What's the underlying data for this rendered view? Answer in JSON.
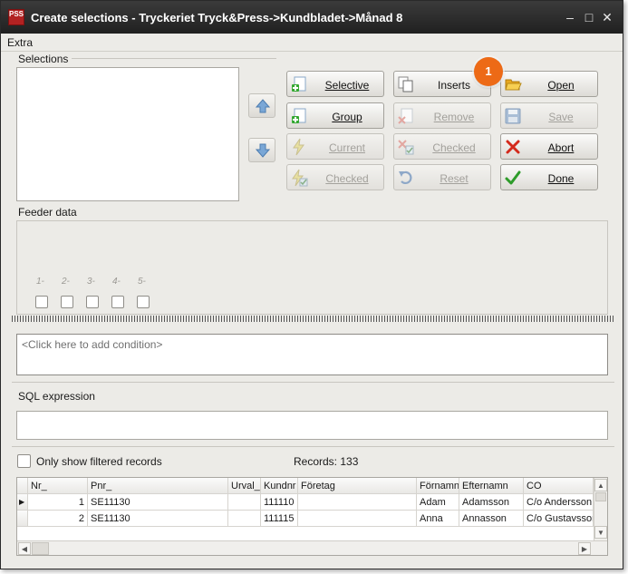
{
  "window": {
    "app_icon_text": "PSS",
    "title": "Create selections - Tryckeriet Tryck&Press->Kundbladet->Månad 8",
    "minimize": "–",
    "maximize": "□",
    "close": "✕"
  },
  "menu": {
    "extra": "Extra"
  },
  "selections": {
    "label": "Selections"
  },
  "buttons": {
    "selective": "Selective",
    "group": "Group",
    "current": "Current",
    "checked_left": "Checked",
    "inserts": "Inserts",
    "remove": "Remove",
    "checked_mid": "Checked",
    "reset": "Reset",
    "open": "Open",
    "save": "Save",
    "abort": "Abort",
    "done": "Done"
  },
  "badge": "1",
  "feeder": {
    "label": "Feeder data",
    "numbers": [
      "1-",
      "2-",
      "3-",
      "4-",
      "5-"
    ]
  },
  "condition": {
    "placeholder": "<Click here to add condition>"
  },
  "sql": {
    "label": "SQL expression",
    "value": ""
  },
  "filter": {
    "label": "Only show filtered records",
    "records": "Records: 133"
  },
  "grid": {
    "columns": [
      "Nr_",
      "Pnr_",
      "Urval_",
      "Kundnr",
      "Företag",
      "Förnamn",
      "Efternamn",
      "CO"
    ],
    "rows": [
      [
        "1",
        "SE11130",
        "",
        "111110",
        "",
        "Adam",
        "Adamsson",
        "C/o Andersson"
      ],
      [
        "2",
        "SE11130",
        "",
        "111115",
        "",
        "Anna",
        "Annasson",
        "C/o Gustavsson"
      ]
    ]
  },
  "icons": {
    "selective": "plus-page-icon",
    "group": "plus-page-icon",
    "current": "lightning-icon",
    "checked_left": "lightning-check-icon",
    "inserts": "copy-pages-icon",
    "remove": "red-x-page-icon",
    "checked_mid": "x-check-page-icon",
    "reset": "undo-arrow-icon",
    "open": "open-folder-icon",
    "save": "floppy-disk-icon",
    "abort": "red-x-icon",
    "done": "green-checkmark-icon"
  },
  "colors": {
    "badge": "#ed6a16",
    "titlebar": "#2a2a2a",
    "abort_x": "#d42a1c",
    "done_check": "#2e9c2a",
    "add_plus": "#35a832"
  }
}
